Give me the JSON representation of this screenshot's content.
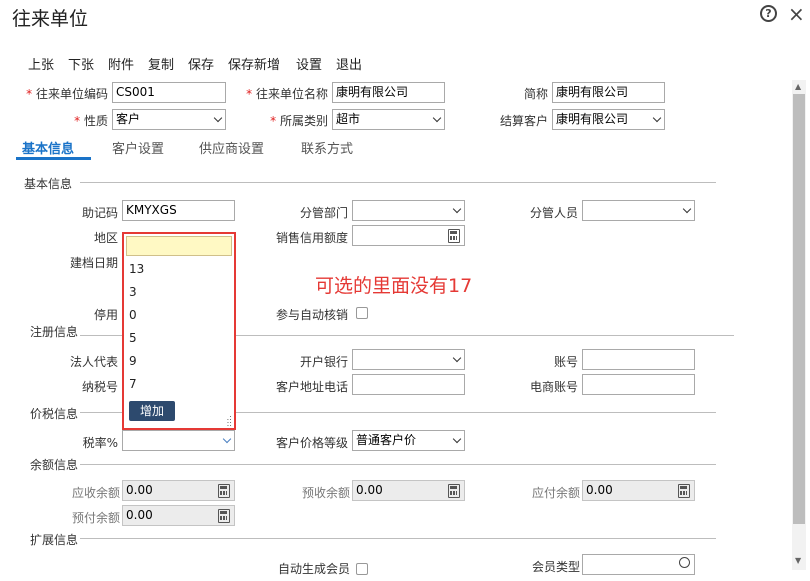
{
  "window": {
    "title": "往来单位",
    "help_icon": "question-icon",
    "close_icon": "close-icon",
    "help_glyph": "?",
    "close_glyph": "×"
  },
  "toolbar": [
    "上张",
    "下张",
    "附件",
    "复制",
    "保存",
    "保存新增",
    "设置",
    "退出"
  ],
  "header": {
    "code_label": "往来单位编码",
    "code_value": "CS001",
    "name_label": "往来单位名称",
    "name_value": "康明有限公司",
    "short_label": "简称",
    "short_value": "康明有限公司",
    "nature_label": "性质",
    "nature_value": "客户",
    "category_label": "所属类别",
    "category_value": "超市",
    "settle_label": "结算客户",
    "settle_value": "康明有限公司"
  },
  "tabs": [
    "基本信息",
    "客户设置",
    "供应商设置",
    "联系方式"
  ],
  "sections": {
    "basic": "基本信息",
    "register": "注册信息",
    "price_tax": "价税信息",
    "balance": "余额信息",
    "extend": "扩展信息"
  },
  "basic": {
    "mnemonic_label": "助记码",
    "mnemonic_value": "KMYXGS",
    "dept_label": "分管部门",
    "staff_label": "分管人员",
    "area_label": "地区",
    "credit_label": "销售信用额度",
    "created_label": "建档日期",
    "disabled_label": "停用",
    "auto_verify_label": "参与自动核销"
  },
  "register": {
    "legal_label": "法人代表",
    "bank_label": "开户银行",
    "account_label": "账号",
    "tax_no_label": "纳税号",
    "addr_label": "客户地址电话",
    "ecom_label": "电商账号"
  },
  "price": {
    "tax_rate_label": "税率%",
    "price_level_label": "客户价格等级",
    "price_level_value": "普通客户价"
  },
  "balance": {
    "receivable_label": "应收余额",
    "receivable_value": "0.00",
    "prereceive_label": "预收余额",
    "prereceive_value": "0.00",
    "payable_label": "应付余额",
    "payable_value": "0.00",
    "prepay_label": "预付余额",
    "prepay_value": "0.00"
  },
  "extend": {
    "auto_member_label": "自动生成会员",
    "member_type_label": "会员类型"
  },
  "dropdown": {
    "items": [
      "13",
      "3",
      "0",
      "5",
      "9",
      "7"
    ],
    "add_button": "增加"
  },
  "annotation": "可选的里面没有17",
  "colors": {
    "accent": "#1a73c8",
    "highlight_border": "#e53935",
    "required": "#e02020",
    "add_button_bg": "#2d4a6e"
  }
}
